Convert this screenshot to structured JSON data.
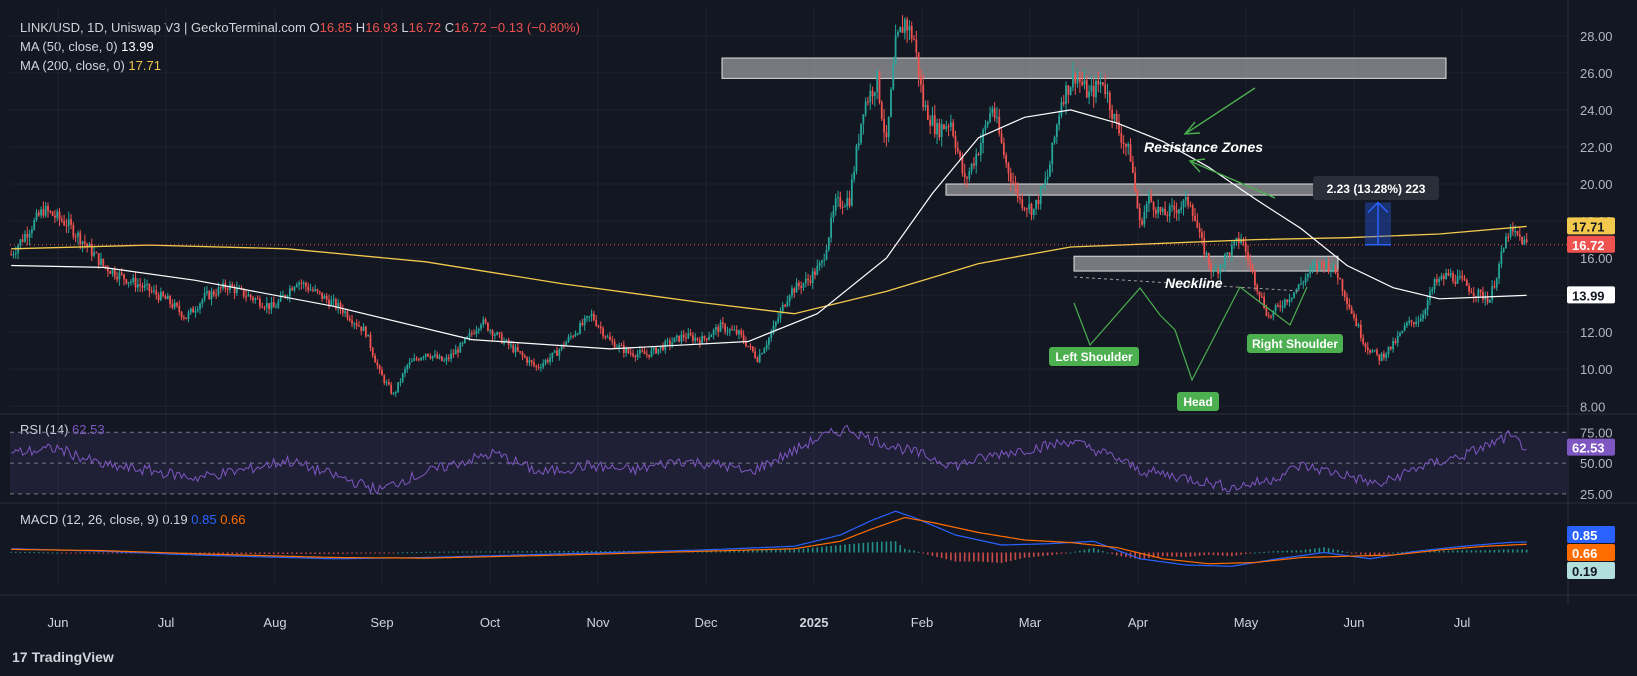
{
  "header": {
    "symbol": "LINK/USD, 1D, Uniswap V3 | GeckoTerminal.com",
    "o_label": "O",
    "o_value": "16.85",
    "h_label": "H",
    "h_value": "16.93",
    "l_label": "L",
    "l_value": "16.72",
    "c_label": "C",
    "c_value": "16.72",
    "change": "−0.13 (−0.80%)"
  },
  "indicators": {
    "ma50_label": "MA (50, close, 0)",
    "ma50_value": "13.99",
    "ma200_label": "MA (200, close, 0)",
    "ma200_value": "17.71",
    "rsi_label": "RSI (14)",
    "rsi_value": "62.53",
    "macd_label": "MACD (12, 26, close, 9)",
    "macd_hist": "0.19",
    "macd_line": "0.85",
    "macd_signal": "0.66"
  },
  "brand": {
    "logo": "17",
    "name": "TradingView"
  },
  "colors": {
    "background": "#131722",
    "up": "#26a69a",
    "down": "#ef5350",
    "ma50": "#ffffff",
    "ma200": "#f2c94c",
    "rsi": "#7e57c2",
    "macd": "#2962ff",
    "signal": "#ff6d00",
    "annotation": "#4caf50",
    "measure": "#2962ff"
  },
  "chart_data": {
    "type": "candlestick",
    "x_ticks": [
      "Jun",
      "Jul",
      "Aug",
      "Sep",
      "Oct",
      "Nov",
      "Dec",
      "2025",
      "Feb",
      "Mar",
      "Apr",
      "May",
      "Jun",
      "Jul"
    ],
    "y_ticks": [
      "8.00",
      "10.00",
      "12.00",
      "14.00",
      "16.00",
      "18.00",
      "20.00",
      "22.00",
      "24.00",
      "26.00",
      "28.00"
    ],
    "ylim": [
      7.8,
      29.5
    ],
    "price_path": [
      [
        0,
        16.2
      ],
      [
        8,
        17.6
      ],
      [
        14,
        18.6
      ],
      [
        24,
        17.9
      ],
      [
        32,
        16.8
      ],
      [
        40,
        15.6
      ],
      [
        48,
        15.0
      ],
      [
        58,
        14.4
      ],
      [
        68,
        13.7
      ],
      [
        76,
        12.8
      ],
      [
        84,
        13.9
      ],
      [
        94,
        14.5
      ],
      [
        104,
        13.9
      ],
      [
        114,
        13.3
      ],
      [
        124,
        14.8
      ],
      [
        134,
        14.0
      ],
      [
        144,
        13.2
      ],
      [
        154,
        12.0
      ],
      [
        160,
        9.8
      ],
      [
        166,
        8.6
      ],
      [
        172,
        10.2
      ],
      [
        180,
        10.9
      ],
      [
        188,
        10.4
      ],
      [
        196,
        11.3
      ],
      [
        204,
        12.6
      ],
      [
        212,
        11.7
      ],
      [
        220,
        10.9
      ],
      [
        228,
        10.1
      ],
      [
        236,
        10.8
      ],
      [
        244,
        11.9
      ],
      [
        252,
        12.9
      ],
      [
        260,
        11.5
      ],
      [
        268,
        10.9
      ],
      [
        276,
        10.8
      ],
      [
        284,
        11.3
      ],
      [
        292,
        11.8
      ],
      [
        300,
        11.6
      ],
      [
        308,
        12.3
      ],
      [
        316,
        11.9
      ],
      [
        324,
        10.6
      ],
      [
        330,
        11.9
      ],
      [
        338,
        14.2
      ],
      [
        346,
        14.8
      ],
      [
        352,
        15.7
      ],
      [
        358,
        18.9
      ],
      [
        364,
        19.2
      ],
      [
        370,
        24.2
      ],
      [
        376,
        25.6
      ],
      [
        380,
        22.1
      ],
      [
        384,
        27.5
      ],
      [
        388,
        28.8
      ],
      [
        392,
        27.8
      ],
      [
        396,
        24.3
      ],
      [
        402,
        22.9
      ],
      [
        408,
        23.4
      ],
      [
        414,
        20.1
      ],
      [
        420,
        21.9
      ],
      [
        426,
        24.2
      ],
      [
        432,
        21.1
      ],
      [
        438,
        19.1
      ],
      [
        444,
        18.6
      ],
      [
        450,
        20.4
      ],
      [
        456,
        24.6
      ],
      [
        462,
        25.9
      ],
      [
        468,
        24.8
      ],
      [
        474,
        25.6
      ],
      [
        480,
        23.1
      ],
      [
        486,
        21.5
      ],
      [
        490,
        17.8
      ],
      [
        494,
        19.2
      ],
      [
        500,
        18.3
      ],
      [
        506,
        18.7
      ],
      [
        512,
        19.1
      ],
      [
        516,
        17.1
      ],
      [
        522,
        15.1
      ],
      [
        528,
        16.2
      ],
      [
        534,
        17.1
      ],
      [
        540,
        14.8
      ],
      [
        546,
        12.8
      ],
      [
        552,
        13.6
      ],
      [
        558,
        14.3
      ],
      [
        564,
        15.3
      ],
      [
        570,
        15.8
      ],
      [
        576,
        15.1
      ],
      [
        582,
        13.1
      ],
      [
        588,
        11.3
      ],
      [
        594,
        10.6
      ],
      [
        600,
        11.3
      ],
      [
        606,
        12.4
      ],
      [
        612,
        12.8
      ],
      [
        618,
        14.6
      ],
      [
        624,
        15.1
      ],
      [
        630,
        14.7
      ],
      [
        636,
        14.1
      ],
      [
        642,
        13.8
      ],
      [
        646,
        15.6
      ],
      [
        650,
        17.4
      ],
      [
        654,
        17.2
      ],
      [
        658,
        16.72
      ]
    ],
    "ma50_values": [
      [
        0,
        15.6
      ],
      [
        40,
        15.5
      ],
      [
        80,
        14.8
      ],
      [
        140,
        13.4
      ],
      [
        200,
        11.6
      ],
      [
        260,
        11.1
      ],
      [
        320,
        11.5
      ],
      [
        350,
        13.0
      ],
      [
        380,
        16.0
      ],
      [
        400,
        19.5
      ],
      [
        420,
        22.5
      ],
      [
        440,
        23.6
      ],
      [
        460,
        24.0
      ],
      [
        480,
        23.3
      ],
      [
        500,
        22.3
      ],
      [
        520,
        20.9
      ],
      [
        540,
        19.2
      ],
      [
        560,
        17.6
      ],
      [
        580,
        15.6
      ],
      [
        600,
        14.4
      ],
      [
        620,
        13.8
      ],
      [
        640,
        13.9
      ],
      [
        658,
        13.99
      ]
    ],
    "ma200_values": [
      [
        0,
        16.5
      ],
      [
        60,
        16.7
      ],
      [
        120,
        16.5
      ],
      [
        180,
        15.8
      ],
      [
        240,
        14.6
      ],
      [
        300,
        13.6
      ],
      [
        340,
        13.0
      ],
      [
        380,
        14.2
      ],
      [
        420,
        15.7
      ],
      [
        460,
        16.6
      ],
      [
        500,
        16.8
      ],
      [
        540,
        17.0
      ],
      [
        580,
        17.1
      ],
      [
        620,
        17.3
      ],
      [
        658,
        17.71
      ]
    ],
    "zones": [
      {
        "from_bar": 372,
        "to_bar": 676,
        "low": 25.7,
        "high": 26.8
      },
      {
        "from_bar": 486,
        "to_bar": 676,
        "low": 19.4,
        "high": 20.0
      },
      {
        "from_bar": 520,
        "to_bar": 640,
        "low": 15.3,
        "high": 16.1
      }
    ],
    "last_price_label": "16.72",
    "ma200_label": "17.71",
    "ma50_label": "13.99",
    "annotations": {
      "resistance": "Resistance Zones",
      "neckline": "Neckline",
      "left_shoulder": "Left Shoulder",
      "head": "Head",
      "right_shoulder": "Right Shoulder",
      "measure": "2.23 (13.28%) 223"
    },
    "rsi": {
      "ticks": [
        "25.00",
        "50.00",
        "75.00"
      ],
      "ylim": [
        20,
        85
      ],
      "path": [
        [
          0,
          58
        ],
        [
          20,
          62
        ],
        [
          40,
          48
        ],
        [
          60,
          44
        ],
        [
          80,
          38
        ],
        [
          100,
          44
        ],
        [
          120,
          52
        ],
        [
          140,
          40
        ],
        [
          150,
          34
        ],
        [
          160,
          28
        ],
        [
          170,
          36
        ],
        [
          190,
          48
        ],
        [
          210,
          58
        ],
        [
          230,
          42
        ],
        [
          250,
          48
        ],
        [
          270,
          44
        ],
        [
          290,
          52
        ],
        [
          310,
          48
        ],
        [
          320,
          42
        ],
        [
          340,
          60
        ],
        [
          350,
          70
        ],
        [
          358,
          75
        ],
        [
          364,
          78
        ],
        [
          372,
          70
        ],
        [
          390,
          60
        ],
        [
          410,
          48
        ],
        [
          430,
          58
        ],
        [
          450,
          64
        ],
        [
          460,
          68
        ],
        [
          480,
          54
        ],
        [
          490,
          44
        ],
        [
          510,
          38
        ],
        [
          530,
          30
        ],
        [
          546,
          36
        ],
        [
          560,
          48
        ],
        [
          580,
          40
        ],
        [
          594,
          32
        ],
        [
          610,
          46
        ],
        [
          630,
          56
        ],
        [
          646,
          68
        ],
        [
          650,
          72
        ],
        [
          658,
          62.53
        ]
      ]
    },
    "macd": {
      "ylim": [
        -2.6,
        3.8
      ],
      "macd_path": [
        [
          0,
          0.3
        ],
        [
          40,
          0.1
        ],
        [
          80,
          -0.2
        ],
        [
          140,
          -0.5
        ],
        [
          180,
          -0.4
        ],
        [
          240,
          -0.1
        ],
        [
          300,
          0.2
        ],
        [
          340,
          0.5
        ],
        [
          360,
          1.4
        ],
        [
          374,
          2.6
        ],
        [
          384,
          3.3
        ],
        [
          392,
          2.8
        ],
        [
          410,
          1.4
        ],
        [
          430,
          0.6
        ],
        [
          450,
          0.7
        ],
        [
          470,
          0.9
        ],
        [
          490,
          -0.5
        ],
        [
          510,
          -1.0
        ],
        [
          530,
          -1.1
        ],
        [
          550,
          -0.5
        ],
        [
          570,
          0.0
        ],
        [
          590,
          -0.5
        ],
        [
          610,
          0.1
        ],
        [
          630,
          0.5
        ],
        [
          650,
          0.8
        ],
        [
          658,
          0.85
        ]
      ],
      "signal_path": [
        [
          0,
          0.25
        ],
        [
          40,
          0.15
        ],
        [
          80,
          -0.1
        ],
        [
          140,
          -0.4
        ],
        [
          180,
          -0.45
        ],
        [
          240,
          -0.2
        ],
        [
          300,
          0.1
        ],
        [
          340,
          0.3
        ],
        [
          360,
          0.9
        ],
        [
          374,
          1.9
        ],
        [
          388,
          2.8
        ],
        [
          400,
          2.4
        ],
        [
          420,
          1.6
        ],
        [
          440,
          1.0
        ],
        [
          460,
          0.8
        ],
        [
          480,
          0.4
        ],
        [
          500,
          -0.5
        ],
        [
          520,
          -0.9
        ],
        [
          540,
          -0.8
        ],
        [
          560,
          -0.4
        ],
        [
          580,
          -0.3
        ],
        [
          600,
          -0.2
        ],
        [
          620,
          0.2
        ],
        [
          640,
          0.5
        ],
        [
          658,
          0.66
        ]
      ]
    }
  }
}
